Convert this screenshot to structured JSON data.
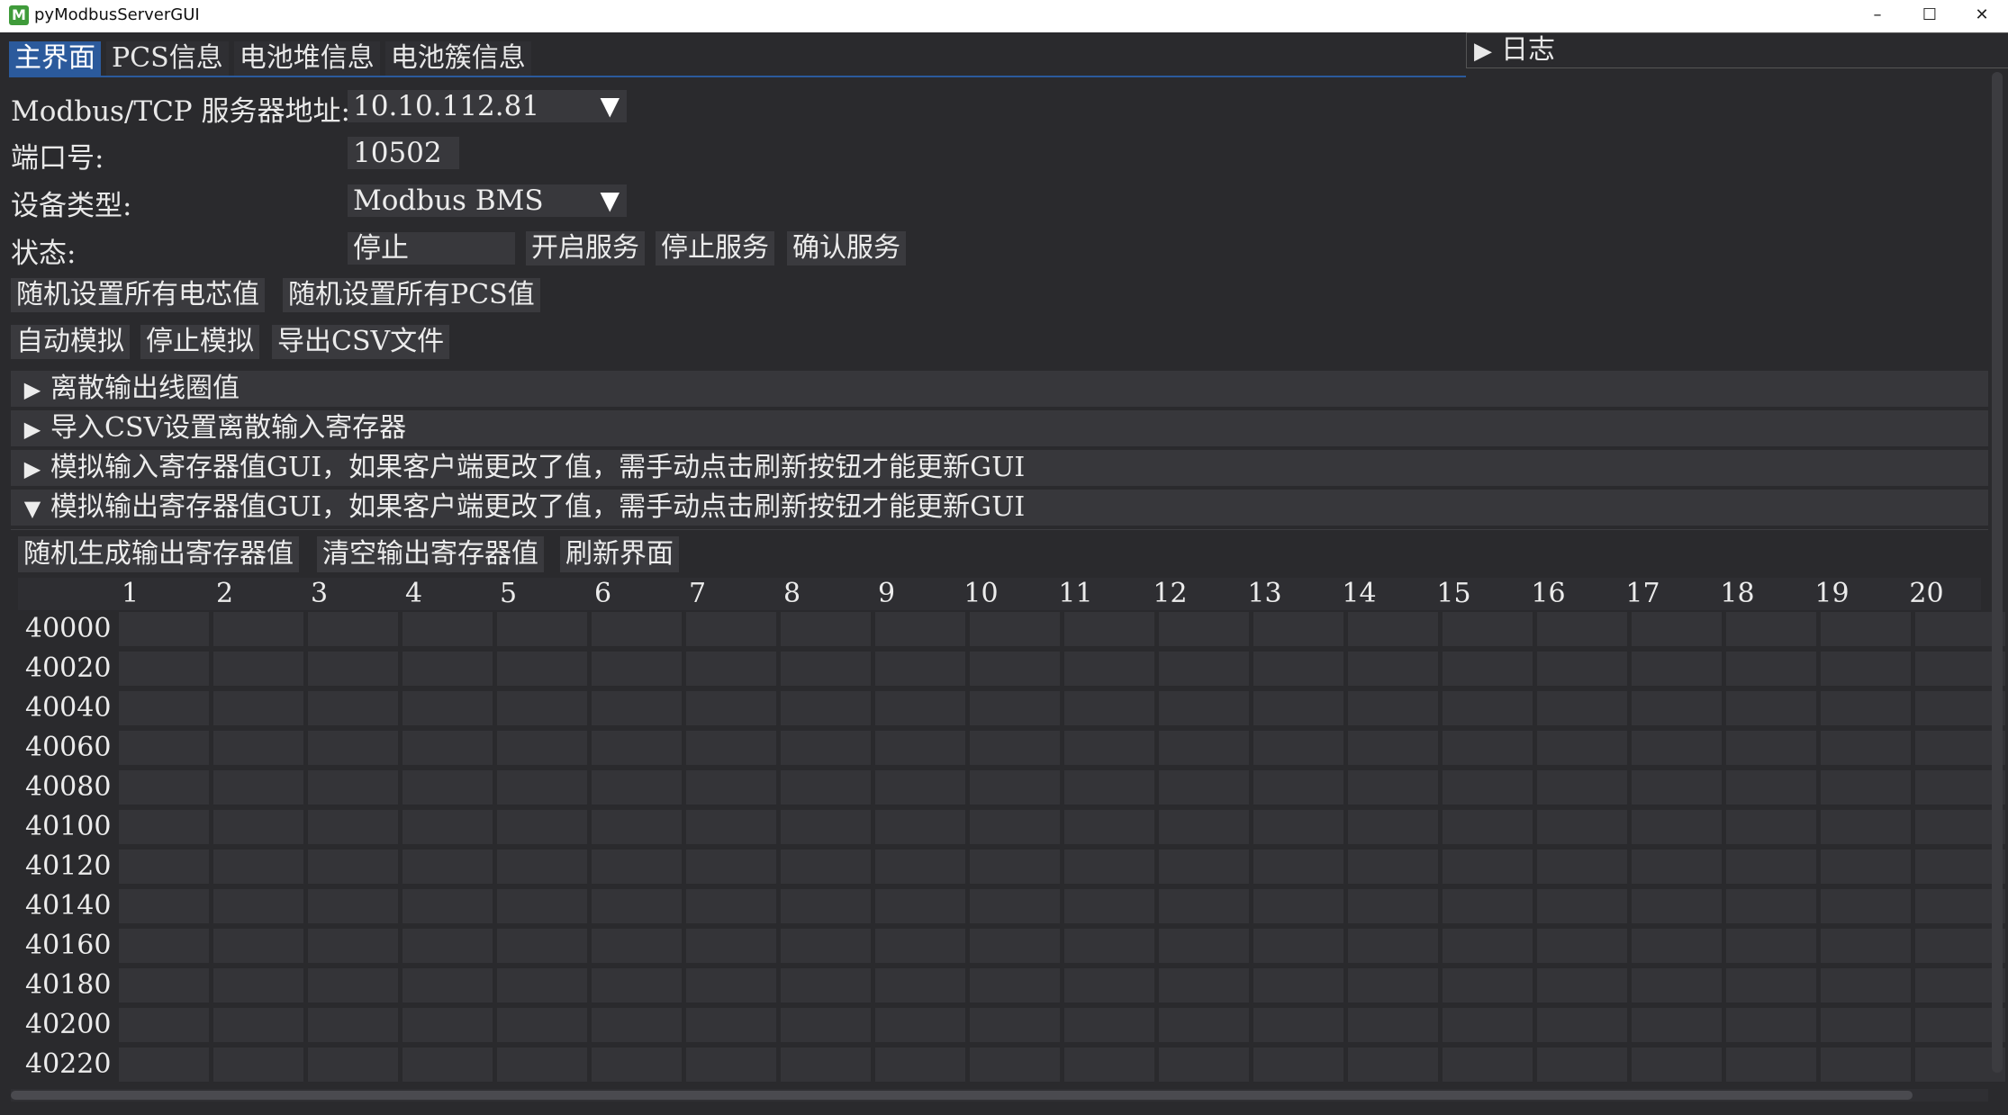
{
  "window": {
    "title": "pyModbusServerGUI",
    "icon_letter": "M",
    "minimize_glyph": "–",
    "maximize_glyph": "☐",
    "close_glyph": "✕"
  },
  "tabs": [
    {
      "label": "主界面",
      "active": true
    },
    {
      "label": "PCS信息",
      "active": false
    },
    {
      "label": "电池堆信息",
      "active": false
    },
    {
      "label": "电池簇信息",
      "active": false
    }
  ],
  "log": {
    "label": "日志",
    "arrow": "▶"
  },
  "form": {
    "server_label": "Modbus/TCP 服务器地址:",
    "server_value": "10.10.112.81",
    "port_label": "端口号:",
    "port_value": "10502",
    "device_label": "设备类型:",
    "device_value": "Modbus BMS",
    "status_label": "状态:",
    "status_value": "停止",
    "caret": "▼"
  },
  "buttons": {
    "start_service": "开启服务",
    "stop_service": "停止服务",
    "confirm_service": "确认服务",
    "random_cells": "随机设置所有电芯值",
    "random_pcs": "随机设置所有PCS值",
    "auto_sim": "自动模拟",
    "stop_sim": "停止模拟",
    "export_csv": "导出CSV文件"
  },
  "sections": [
    {
      "label": "离散输出线圈值",
      "expanded": false,
      "arrow": "▶"
    },
    {
      "label": "导入CSV设置离散输入寄存器",
      "expanded": false,
      "arrow": "▶"
    },
    {
      "label": "模拟输入寄存器值GUI，如果客户端更改了值，需手动点击刷新按钮才能更新GUI",
      "expanded": false,
      "arrow": "▶"
    },
    {
      "label": "模拟输出寄存器值GUI，如果客户端更改了值，需手动点击刷新按钮才能更新GUI",
      "expanded": true,
      "arrow": "▼"
    }
  ],
  "holding": {
    "random_btn": "随机生成输出寄存器值",
    "clear_btn": "清空输出寄存器值",
    "refresh_btn": "刷新界面",
    "columns": [
      "1",
      "2",
      "3",
      "4",
      "5",
      "6",
      "7",
      "8",
      "9",
      "10",
      "11",
      "12",
      "13",
      "14",
      "15",
      "16",
      "17",
      "18",
      "19",
      "20"
    ],
    "rows": [
      "40000",
      "40020",
      "40040",
      "40060",
      "40080",
      "40100",
      "40120",
      "40140",
      "40160",
      "40180",
      "40200",
      "40220"
    ]
  }
}
